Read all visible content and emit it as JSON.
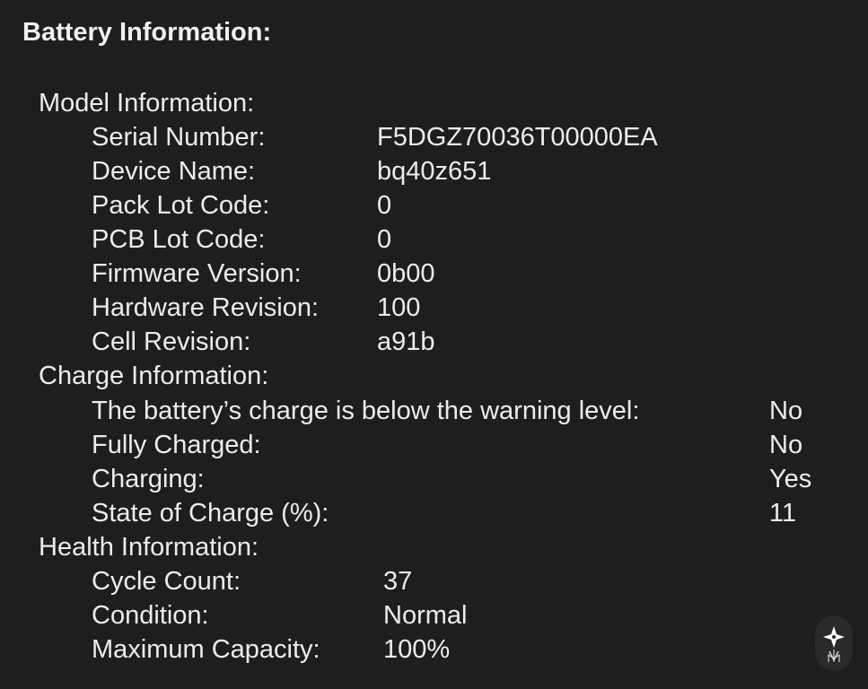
{
  "title": "Battery Information:",
  "model": {
    "heading": "Model Information:",
    "rows": [
      {
        "label": "Serial Number:",
        "value": "F5DGZ70036T00000EA"
      },
      {
        "label": "Device Name:",
        "value": "bq40z651"
      },
      {
        "label": "Pack Lot Code:",
        "value": "0"
      },
      {
        "label": "PCB Lot Code:",
        "value": "0"
      },
      {
        "label": "Firmware Version:",
        "value": "0b00"
      },
      {
        "label": "Hardware Revision:",
        "value": "100"
      },
      {
        "label": "Cell Revision:",
        "value": "a91b"
      }
    ]
  },
  "charge": {
    "heading": "Charge Information:",
    "rows": [
      {
        "label": "The battery’s charge is below the warning level:",
        "value": "No"
      },
      {
        "label": "Fully Charged:",
        "value": "No"
      },
      {
        "label": "Charging:",
        "value": "Yes"
      },
      {
        "label": "State of Charge (%):",
        "value": "11"
      }
    ]
  },
  "health": {
    "heading": "Health Information:",
    "rows": [
      {
        "label": "Cycle Count:",
        "value": "37"
      },
      {
        "label": "Condition:",
        "value": "Normal"
      },
      {
        "label": "Maximum Capacity:",
        "value": "100%"
      }
    ]
  },
  "colors": {
    "background": "#1e1e1e",
    "text": "#ececec"
  },
  "watermark_icon": "sparkle-logo-icon"
}
